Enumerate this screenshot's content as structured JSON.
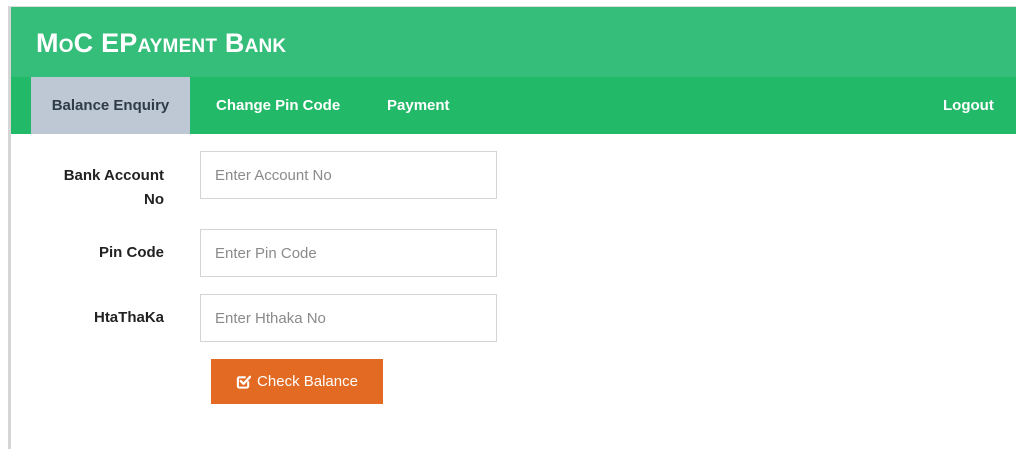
{
  "app": {
    "brand": "MoC EPayment Bank",
    "header_color": "#35bd7a",
    "navbar_color": "#22ba68",
    "active_tab_color": "#bdc8d4",
    "button_color": "#e36a22"
  },
  "nav": {
    "balance_enquiry": "Balance Enquiry",
    "change_pin_code": "Change Pin Code",
    "payment": "Payment",
    "logout": "Logout"
  },
  "form": {
    "account_label": "Bank Account No",
    "account_placeholder": "Enter Account No",
    "account_value": "",
    "pin_label": "Pin Code",
    "pin_placeholder": "Enter Pin Code",
    "pin_value": "",
    "htathaka_label": "HtaThaKa",
    "htathaka_placeholder": "Enter Hthaka No",
    "htathaka_value": "",
    "submit_icon": "check-square-icon",
    "submit_label": "Check Balance"
  }
}
